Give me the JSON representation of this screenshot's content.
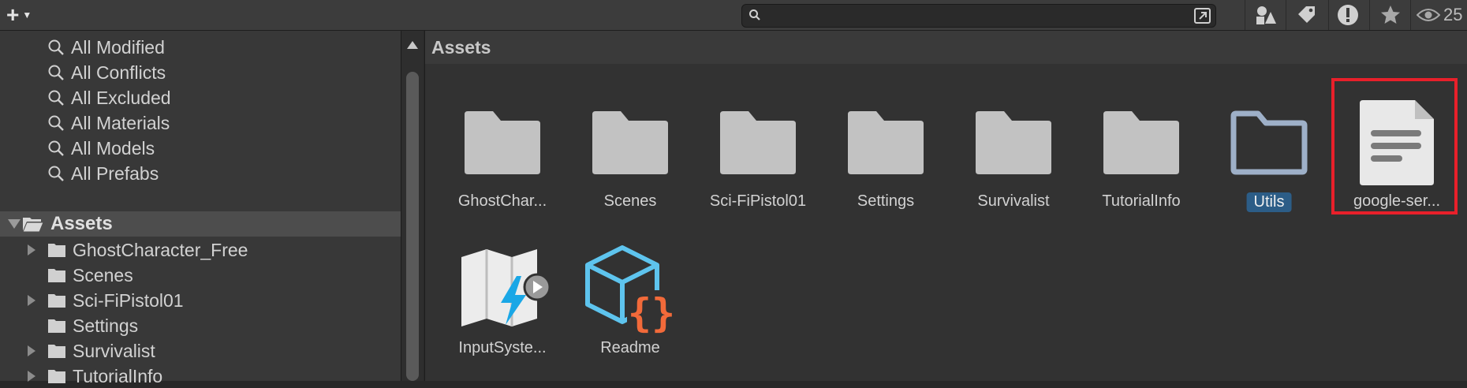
{
  "toolbar": {
    "search": {
      "value": "",
      "placeholder": ""
    },
    "eye_count": "25"
  },
  "favorites": [
    "All Modified",
    "All Conflicts",
    "All Excluded",
    "All Materials",
    "All Models",
    "All Prefabs"
  ],
  "tree": {
    "root": "Assets",
    "items": [
      {
        "label": "GhostCharacter_Free",
        "expandable": true
      },
      {
        "label": "Scenes",
        "expandable": false
      },
      {
        "label": "Sci-FiPistol01",
        "expandable": true
      },
      {
        "label": "Settings",
        "expandable": false
      },
      {
        "label": "Survivalist",
        "expandable": true
      },
      {
        "label": "TutorialInfo",
        "expandable": true
      }
    ]
  },
  "breadcrumb": "Assets",
  "grid": {
    "items": [
      {
        "label": "GhostChar...",
        "icon": "folder-icon"
      },
      {
        "label": "Scenes",
        "icon": "folder-icon"
      },
      {
        "label": "Sci-FiPistol01",
        "icon": "folder-icon"
      },
      {
        "label": "Settings",
        "icon": "folder-icon"
      },
      {
        "label": "Survivalist",
        "icon": "folder-icon"
      },
      {
        "label": "TutorialInfo",
        "icon": "folder-icon"
      },
      {
        "label": "Utils",
        "icon": "folder-outline-icon",
        "selected": true
      },
      {
        "label": "google-ser...",
        "icon": "text-file-icon"
      },
      {
        "label": "InputSyste...",
        "icon": "input-actions-icon"
      },
      {
        "label": "Readme",
        "icon": "json-cube-icon"
      }
    ]
  },
  "colors": {
    "selection": "#2c5d87",
    "highlight": "#e8202a",
    "folder": "#c2c2c2"
  }
}
